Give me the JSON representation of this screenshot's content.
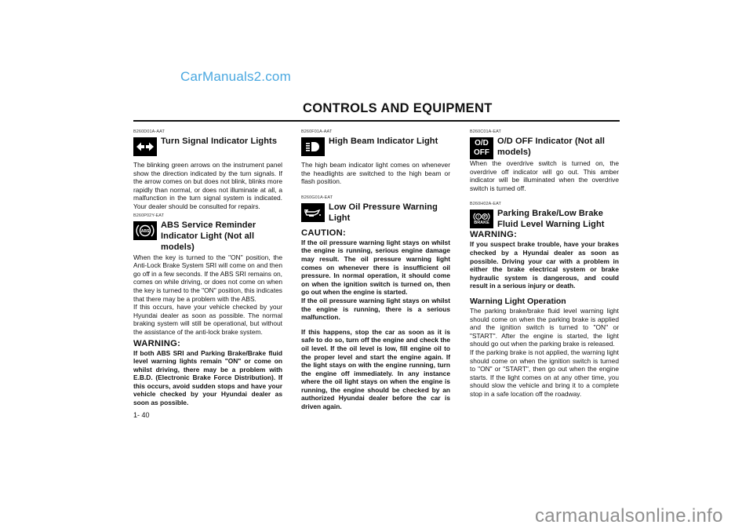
{
  "watermarks": {
    "top": "CarManuals2.com",
    "bottom": "carmanualsonline.info"
  },
  "header": {
    "title": "CONTROLS AND EQUIPMENT"
  },
  "page_number": "1- 40",
  "columns": [
    {
      "sections": [
        {
          "code": "B260D01A-AAT",
          "icon": "turn-signal-arrows-icon",
          "title": "Turn Signal Indicator Lights",
          "body": "The blinking green arrows on the instrument panel show the direction indicated by the turn signals. If the arrow comes on but does not blink, blinks more rapidly than normal, or does not illuminate at all, a malfunction in the turn signal system is indicated. Your dealer should be consulted for repairs."
        },
        {
          "code": "B260P02Y-EAT",
          "icon": "abs-icon",
          "icon_text": "ABS",
          "title": "ABS Service Reminder Indicator Light (Not all models)",
          "body_paragraphs": [
            "When the key is turned to the \"ON\" position, the Anti-Lock Brake System SRI will come on and then go off in a few seconds. If the ABS SRI remains on, comes on while driving, or does not come on when the key is turned to the \"ON\" position, this indicates that there may be a problem with the ABS.",
            "If this occurs, have your vehicle checked by your Hyundai dealer as soon as possible. The normal braking system will still be operational, but without the assistance of the anti-lock brake system."
          ],
          "warning_label": "WARNING:",
          "warning_text": "If both ABS SRI and Parking Brake/Brake fluid level warning lights remain \"ON\" or come on whilst driving, there may be a problem with E.B.D. (Electronic Brake Force Distribution). If this occurs, avoid sudden stops and have your vehicle checked by your Hyundai dealer as soon as possible."
        }
      ]
    },
    {
      "sections": [
        {
          "code": "B260F01A-AAT",
          "icon": "high-beam-icon",
          "title": "High Beam Indicator Light",
          "body": "The high beam indicator light comes on whenever the headlights are  switched to the high beam  or flash position."
        },
        {
          "code": "B260G01A-EAT",
          "icon": "oil-can-icon",
          "title": "Low Oil Pressure Warning Light",
          "caution_label": "CAUTION:",
          "caution_paragraphs": [
            "If the oil pressure warning light stays on whilst the engine is running, serious engine damage may result. The oil pressure warning light comes on whenever there is insufficient oil pressure. In normal operation, it should come on when the ignition switch is turned on, then go out when the engine is started.",
            "If the oil pressure warning light stays on whilst the engine is running, there is a serious malfunction.",
            "If this happens, stop the car as soon as it is safe to do so, turn off the engine and check the oil level. If the oil level is low, fill engine oil to the proper level and start the engine again. If the light stays on with the engine running, turn the engine off immediately. In any instance where the oil light stays on when the engine is running, the engine should be checked by an authorized Hyundai dealer before the car is driven again."
          ]
        }
      ]
    },
    {
      "sections": [
        {
          "code": "B260C01A-EAT",
          "icon": "od-off-icon",
          "icon_text_top": "O/D",
          "icon_text_bottom": "OFF",
          "title": "O/D OFF Indicator (Not all models)",
          "body": "When the overdrive switch is turned on, the overdrive off indicator will go out. This amber indicator will be illuminated when the overdrive switch is turned off."
        },
        {
          "code": "B260H02A-EAT",
          "icon": "brake-warning-icon",
          "icon_text_bottom": "BRAKE",
          "title": "Parking Brake/Low Brake Fluid Level Warning Light",
          "warning_label": "WARNING:",
          "warning_text": "If you suspect brake trouble, have your brakes checked by a Hyundai dealer as soon as possible. Driving your car with a problem in either the brake electrical system or brake hydraulic system is dangerous, and could result in a serious injury or death.",
          "subheading": "Warning Light Operation",
          "sub_paragraphs": [
            "The parking brake/brake fluid level warning light should come on when the parking brake is applied and the ignition switch is turned to \"ON\" or \"START\". After the engine is started, the light should go out when the parking brake is released.",
            "If the parking brake is not applied, the warning light should come on when the ignition switch is turned to \"ON\" or \"START\", then go out when the engine starts. If the light comes on at any other time, you should slow the vehicle and bring it to a complete stop in a safe location off the roadway."
          ]
        }
      ]
    }
  ]
}
